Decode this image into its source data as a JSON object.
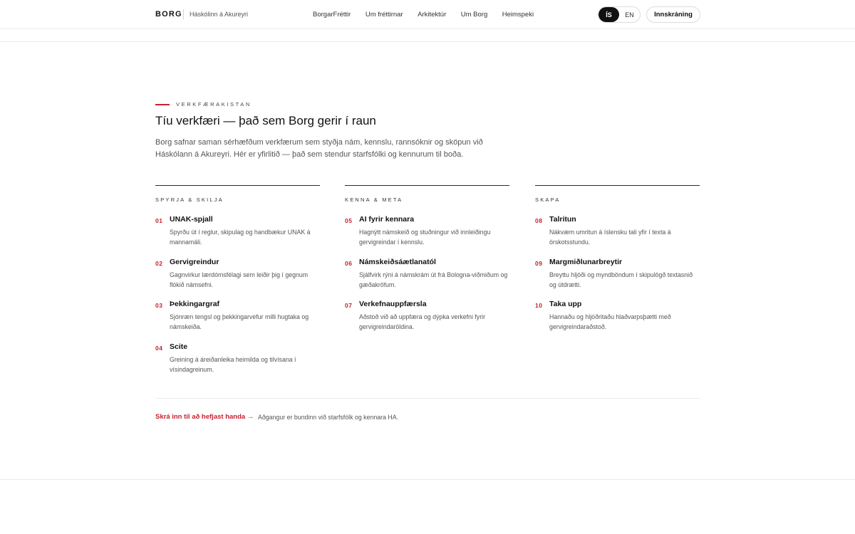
{
  "header": {
    "brand": "BORG",
    "subtitle": "Háskólinn á Akureyri",
    "nav": [
      "BorgarFréttir",
      "Um fréttirnar",
      "Arkitektúr",
      "Um Borg",
      "Heimspeki"
    ],
    "lang_active": "ÍS",
    "lang_other": "EN",
    "login_label": "Innskráning"
  },
  "section": {
    "eyebrow": "VERKFÆRAKISTAN",
    "title": "Tíu verkfæri — það sem Borg gerir í raun",
    "intro": "Borg safnar saman sérhæfðum verkfærum sem styðja nám, kennslu, rannsóknir og sköpun við Háskólann á Akureyri. Hér er yfirlitið — það sem stendur starfsfólki og kennurum til boða."
  },
  "columns": [
    {
      "heading": "SPYRJA & SKILJA",
      "tools": [
        {
          "num": "01",
          "name": "UNAK-spjall",
          "desc": "Spyrðu út í reglur, skipulag og handbækur UNAK á mannamáli."
        },
        {
          "num": "02",
          "name": "Gervigreindur",
          "desc": "Gagnvirkur lærdómsfélagi sem leiðir þig í gegnum flókið námsefni."
        },
        {
          "num": "03",
          "name": "Þekkingargraf",
          "desc": "Sjónræn tengsl og þekkingarvefur milli hugtaka og námskeiða."
        },
        {
          "num": "04",
          "name": "Scite",
          "desc": "Greining á áreiðanleika heimilda og tilvísana í vísindagreinum."
        }
      ]
    },
    {
      "heading": "KENNA & META",
      "tools": [
        {
          "num": "05",
          "name": "AI fyrir kennara",
          "desc": "Hagnýtt námskeið og stuðningur við innleiðingu gervigreindar í kennslu."
        },
        {
          "num": "06",
          "name": "Námskeiðsáætlanatól",
          "desc": "Sjálfvirk rýni á námskrám út frá Bologna-viðmiðum og gæðakröfum."
        },
        {
          "num": "07",
          "name": "Verkefnauppfærsla",
          "desc": "Aðstoð við að uppfæra og dýpka verkefni fyrir gervigreindaröldina."
        }
      ]
    },
    {
      "heading": "SKAPA",
      "tools": [
        {
          "num": "08",
          "name": "Talritun",
          "desc": "Nákvæm umritun á íslensku tali yfir í texta á örskotsstundu."
        },
        {
          "num": "09",
          "name": "Margmiðlunarbreytir",
          "desc": "Breyttu hljóði og myndböndum í skipulögð textasnið og útdrætti."
        },
        {
          "num": "10",
          "name": "Taka upp",
          "desc": "Hannaðu og hljóðritaðu hlaðvarpsþætti með gervigreindaraðstoð."
        }
      ]
    }
  ],
  "footer": {
    "cta": "Skrá inn til að hefjast handa →",
    "note": "Aðgangur er bundinn við starfsfólk og kennara HA."
  },
  "colors": {
    "accent": "#c8202f",
    "text": "#111111",
    "muted": "#555555"
  }
}
